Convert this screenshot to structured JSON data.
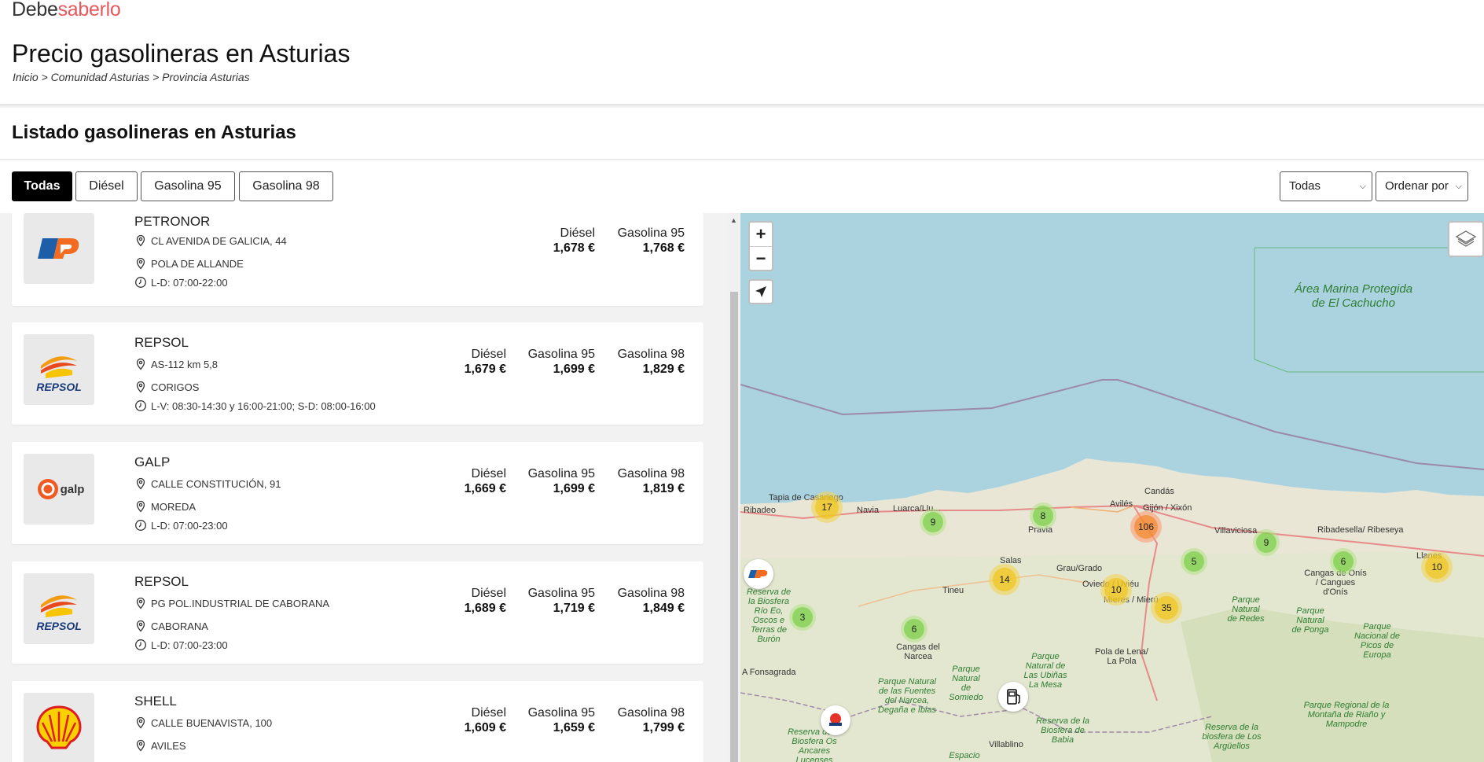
{
  "brand": {
    "part1": "Debe",
    "part2": "saberlo"
  },
  "page_title": "Precio gasolineras en Asturias",
  "breadcrumb": "Inicio > Comunidad Asturias > Provincia Asturias",
  "list_title": "Listado gasolineras en Asturias",
  "filters": [
    "Todas",
    "Diésel",
    "Gasolina 95",
    "Gasolina 98"
  ],
  "selects": {
    "brand": "Todas",
    "order": "Ordenar por"
  },
  "stations": [
    {
      "brand": "PETRONOR",
      "address": "CL AVENIDA DE GALICIA, 44",
      "town": "POLA DE ALLANDE",
      "hours": "L-D: 07:00-22:00",
      "fuels": [
        {
          "name": "Diésel",
          "price": "1,678 €"
        },
        {
          "name": "Gasolina 95",
          "price": "1,768 €"
        }
      ]
    },
    {
      "brand": "REPSOL",
      "address": "AS-112 km 5,8",
      "town": "CORIGOS",
      "hours": "L-V: 08:30-14:30 y 16:00-21:00; S-D: 08:00-16:00",
      "fuels": [
        {
          "name": "Diésel",
          "price": "1,679 €"
        },
        {
          "name": "Gasolina 95",
          "price": "1,699 €"
        },
        {
          "name": "Gasolina 98",
          "price": "1,829 €"
        }
      ]
    },
    {
      "brand": "GALP",
      "address": "CALLE CONSTITUCIÓN, 91",
      "town": "MOREDA",
      "hours": "L-D: 07:00-23:00",
      "fuels": [
        {
          "name": "Diésel",
          "price": "1,669 €"
        },
        {
          "name": "Gasolina 95",
          "price": "1,699 €"
        },
        {
          "name": "Gasolina 98",
          "price": "1,819 €"
        }
      ]
    },
    {
      "brand": "REPSOL",
      "address": "PG POL.INDUSTRIAL DE CABORANA",
      "town": "CABORANA",
      "hours": "L-D: 07:00-23:00",
      "fuels": [
        {
          "name": "Diésel",
          "price": "1,689 €"
        },
        {
          "name": "Gasolina 95",
          "price": "1,719 €"
        },
        {
          "name": "Gasolina 98",
          "price": "1,849 €"
        }
      ]
    },
    {
      "brand": "SHELL",
      "address": "CALLE BUENAVISTA, 100",
      "town": "AVILES",
      "hours": "",
      "fuels": [
        {
          "name": "Diésel",
          "price": "1,609 €"
        },
        {
          "name": "Gasolina 95",
          "price": "1,659 €"
        },
        {
          "name": "Gasolina 98",
          "price": "1,799 €"
        }
      ]
    }
  ],
  "map": {
    "zoom_in": "+",
    "zoom_out": "−",
    "marine_area": "Área Marina Protegida de El Cachucho",
    "clusters": [
      "17",
      "9",
      "8",
      "106",
      "9",
      "6",
      "10",
      "5",
      "14",
      "10",
      "35",
      "3",
      "6"
    ],
    "places": [
      "Tapia de Casariego",
      "Ribadeo",
      "Navia",
      "Luarca/Llu...",
      "Avilés",
      "Candás",
      "Gijón / Xixón",
      "Pravia",
      "Villaviciosa",
      "Ribadesella/ Ribeseya",
      "Llanes",
      "Salas",
      "Grau/Grado",
      "Oviedo / Uviéu",
      "Tineu",
      "Cangas de Onís / Cangues d'Onís",
      "Cangas del Narcea",
      "Pola de Lena/ La Pola",
      "A Fonsagrada",
      "Villablino",
      "Mieres / Mierú"
    ],
    "parks": [
      "Reserva de la Biosfera Río Eo, Oscos e Terras de Burón",
      "Parque Natural de las Fuentes del Narcea, Degaña e Ibias",
      "Parque Natural de Somiedo",
      "Parque Natural de Las Ubiñas La Mesa",
      "Reserva de la Biosfera de Babia",
      "Parque Natural de Redes",
      "Parque Natural de Ponga",
      "Parque Nacional de Picos de Europa",
      "Parque Regional de la Montaña de Riaño y Mampodre",
      "Reserva de la biosfera de Los Argüellos",
      "Reserva de la Biosfera Os Ancares Lucenses",
      "Espacio"
    ]
  }
}
